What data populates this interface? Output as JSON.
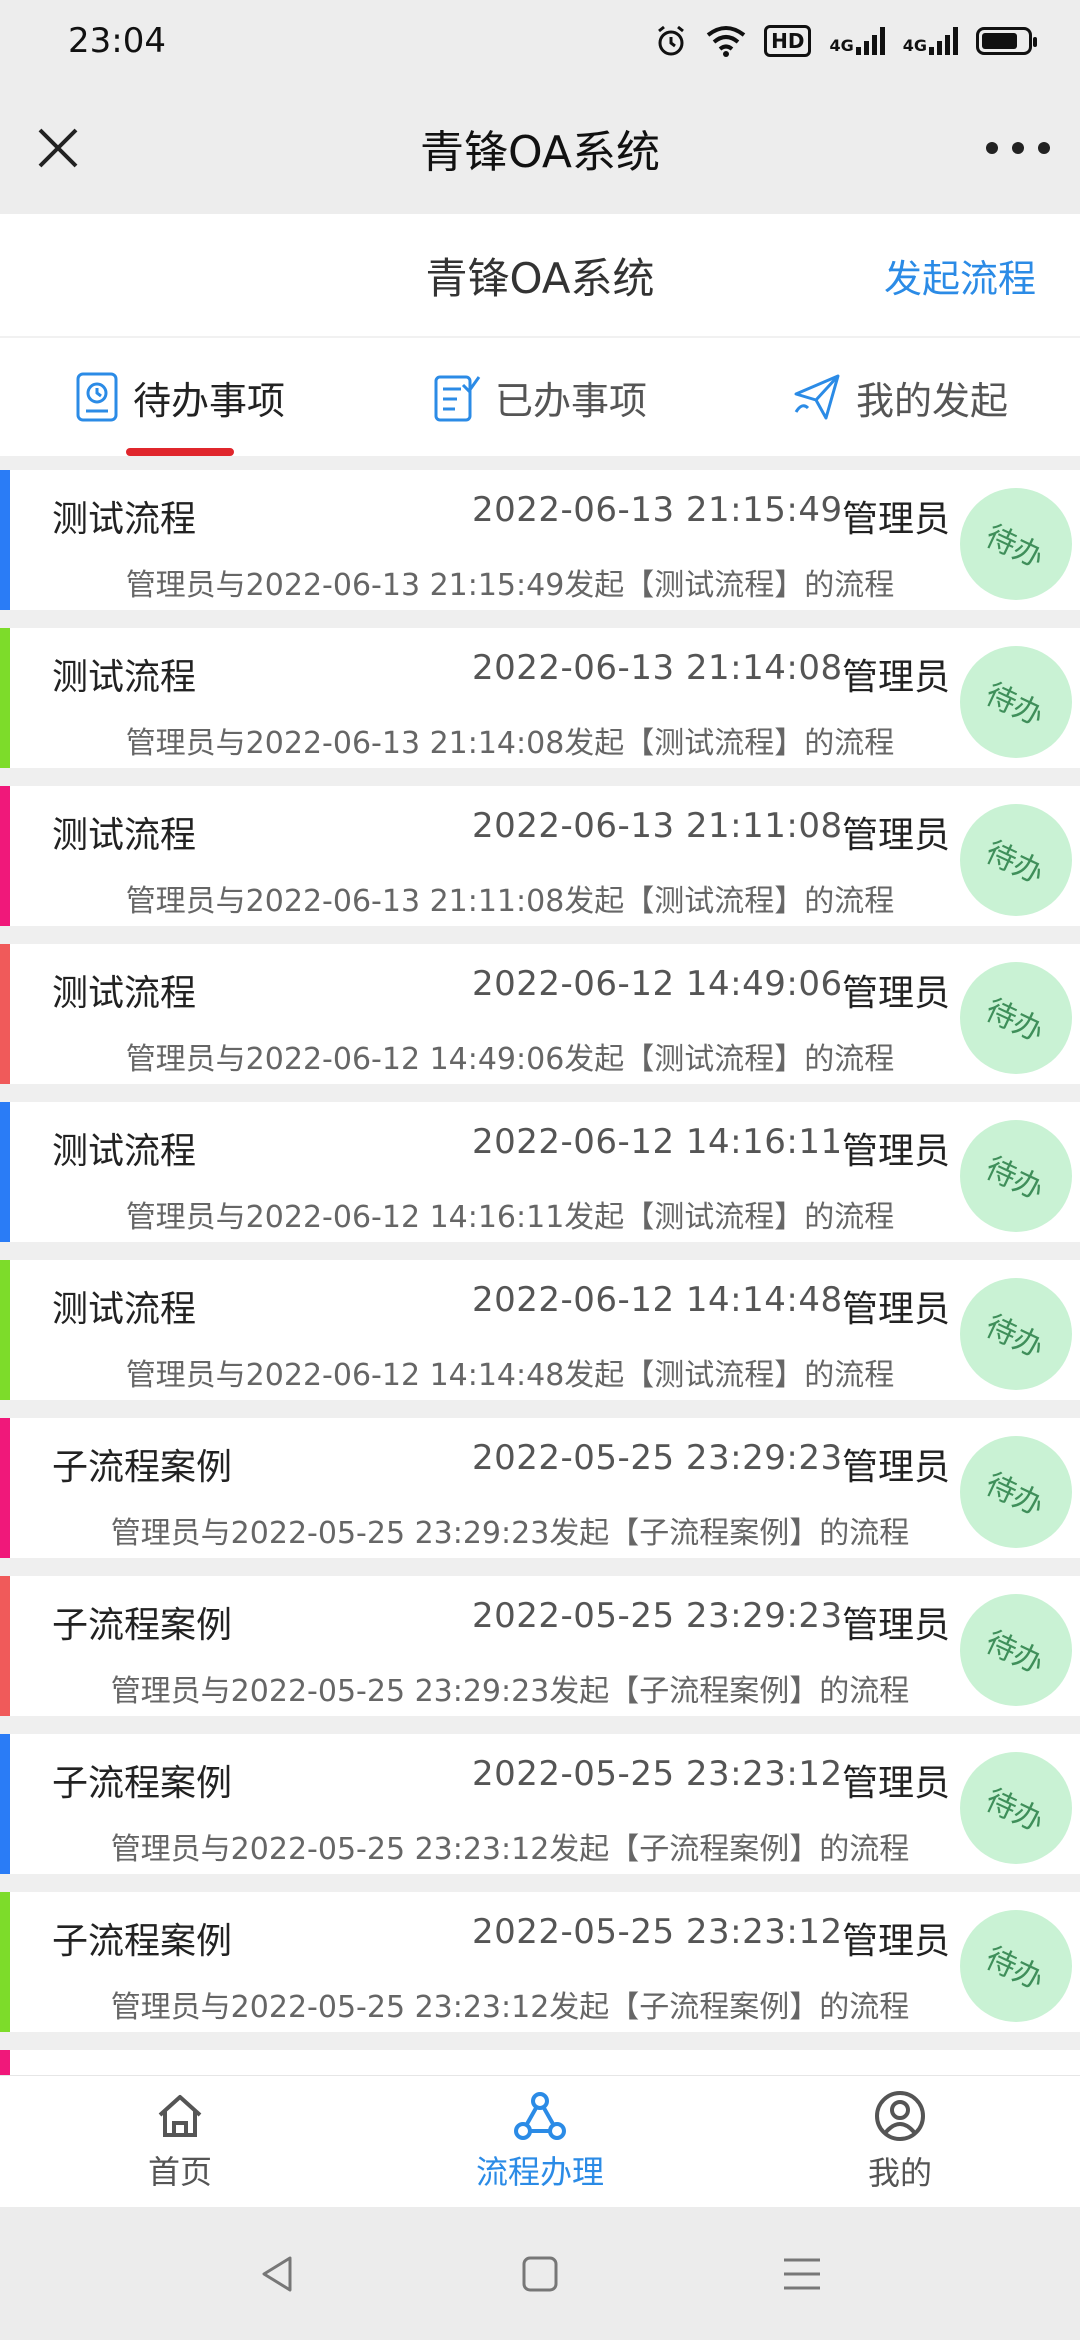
{
  "status": {
    "time": "23:04",
    "hd": "HD",
    "network": [
      "4G",
      "4G"
    ]
  },
  "titlebar": {
    "title": "青锋OA系统"
  },
  "header": {
    "title": "青锋OA系统",
    "start_link": "发起流程"
  },
  "tabs": [
    {
      "label": "待办事项",
      "icon": "todo-icon",
      "active": true
    },
    {
      "label": "已办事项",
      "icon": "done-icon",
      "active": false
    },
    {
      "label": "我的发起",
      "icon": "send-icon",
      "active": false
    }
  ],
  "items": [
    {
      "name": "测试流程",
      "time": "2022-06-13 21:15:49",
      "user": "管理员",
      "desc": "管理员与2022-06-13 21:15:49发起【测试流程】的流程",
      "badge": "待办",
      "color": "#2a7cf6"
    },
    {
      "name": "测试流程",
      "time": "2022-06-13 21:14:08",
      "user": "管理员",
      "desc": "管理员与2022-06-13 21:14:08发起【测试流程】的流程",
      "badge": "待办",
      "color": "#7ddc2a"
    },
    {
      "name": "测试流程",
      "time": "2022-06-13 21:11:08",
      "user": "管理员",
      "desc": "管理员与2022-06-13 21:11:08发起【测试流程】的流程",
      "badge": "待办",
      "color": "#f0187a"
    },
    {
      "name": "测试流程",
      "time": "2022-06-12 14:49:06",
      "user": "管理员",
      "desc": "管理员与2022-06-12 14:49:06发起【测试流程】的流程",
      "badge": "待办",
      "color": "#f05a5a"
    },
    {
      "name": "测试流程",
      "time": "2022-06-12 14:16:11",
      "user": "管理员",
      "desc": "管理员与2022-06-12 14:16:11发起【测试流程】的流程",
      "badge": "待办",
      "color": "#2a7cf6"
    },
    {
      "name": "测试流程",
      "time": "2022-06-12 14:14:48",
      "user": "管理员",
      "desc": "管理员与2022-06-12 14:14:48发起【测试流程】的流程",
      "badge": "待办",
      "color": "#7ddc2a"
    },
    {
      "name": "子流程案例",
      "time": "2022-05-25 23:29:23",
      "user": "管理员",
      "desc": "管理员与2022-05-25 23:29:23发起【子流程案例】的流程",
      "badge": "待办",
      "color": "#f0187a"
    },
    {
      "name": "子流程案例",
      "time": "2022-05-25 23:29:23",
      "user": "管理员",
      "desc": "管理员与2022-05-25 23:29:23发起【子流程案例】的流程",
      "badge": "待办",
      "color": "#f05a5a"
    },
    {
      "name": "子流程案例",
      "time": "2022-05-25 23:23:12",
      "user": "管理员",
      "desc": "管理员与2022-05-25 23:23:12发起【子流程案例】的流程",
      "badge": "待办",
      "color": "#2a7cf6"
    },
    {
      "name": "子流程案例",
      "time": "2022-05-25 23:23:12",
      "user": "管理员",
      "desc": "管理员与2022-05-25 23:23:12发起【子流程案例】的流程",
      "badge": "待办",
      "color": "#7ddc2a"
    }
  ],
  "bottom_nav": [
    {
      "label": "首页",
      "icon": "home-icon",
      "active": false
    },
    {
      "label": "流程办理",
      "icon": "flow-icon",
      "active": true
    },
    {
      "label": "我的",
      "icon": "user-icon",
      "active": false
    }
  ],
  "colors": {
    "accent": "#2b8be6",
    "tab_underline": "#e0262c",
    "badge_bg": "#c9f2d4"
  }
}
